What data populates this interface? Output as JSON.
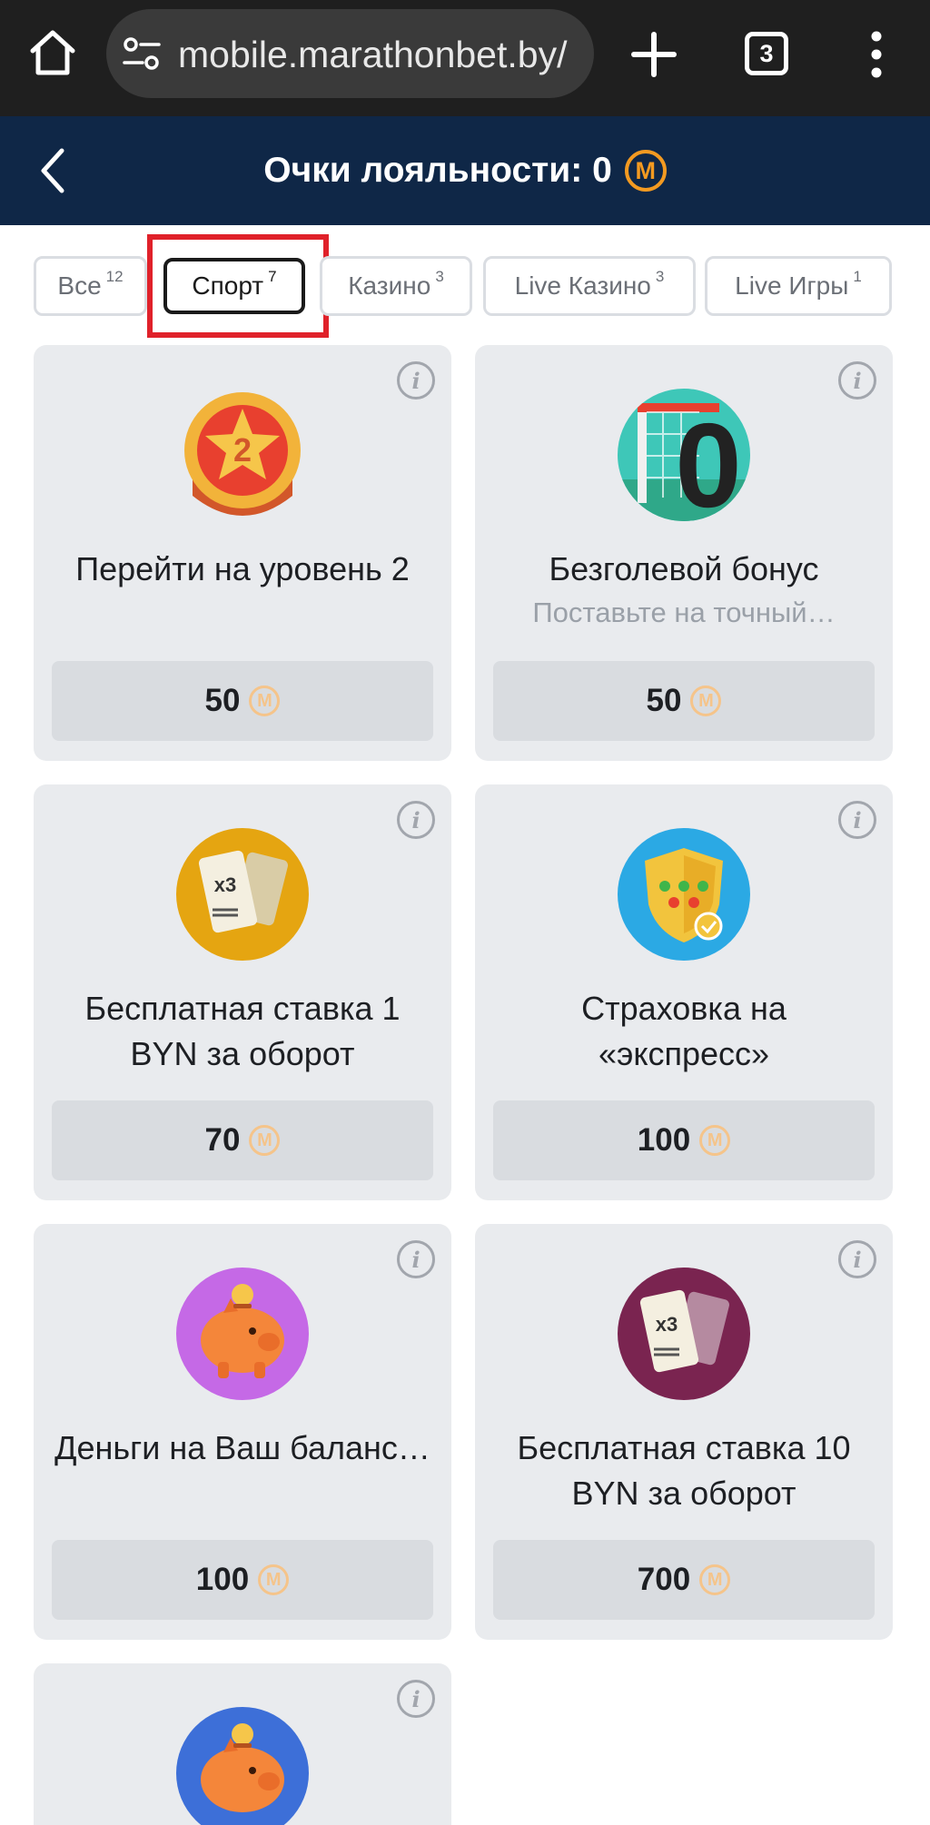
{
  "browser": {
    "url": "mobile.marathonbet.by/",
    "tab_count": "3"
  },
  "header": {
    "title": "Очки лояльности: 0",
    "coin_letter": "M"
  },
  "tabs": [
    {
      "label": "Все",
      "count": "12"
    },
    {
      "label": "Спорт",
      "count": "7"
    },
    {
      "label": "Казино",
      "count": "3"
    },
    {
      "label": "Live Казино",
      "count": "3"
    },
    {
      "label": "Live Игры",
      "count": "1"
    }
  ],
  "info_glyph": "i",
  "coin_letter": "M",
  "cards": [
    {
      "title": "Перейти на уровень 2",
      "subtitle": "",
      "price": "50",
      "icon": "level-2-medal-icon"
    },
    {
      "title": "Безголевой бонус",
      "subtitle": "Поставьте на точный…",
      "price": "50",
      "icon": "zero-goal-icon"
    },
    {
      "title": "Бесплатная ставка 1 BYN за оборот",
      "subtitle": "",
      "price": "70",
      "icon": "free-bet-ticket-gold-icon"
    },
    {
      "title": "Страховка на «экспресс»",
      "subtitle": "",
      "price": "100",
      "icon": "express-insurance-shield-icon"
    },
    {
      "title": "Деньги на Ваш баланс…",
      "subtitle": "",
      "price": "100",
      "icon": "piggy-bank-purple-icon"
    },
    {
      "title": "Бесплатная ставка 10 BYN за оборот",
      "subtitle": "",
      "price": "700",
      "icon": "free-bet-ticket-maroon-icon"
    },
    {
      "title": "",
      "subtitle": "",
      "price": "",
      "icon": "piggy-bank-blue-icon"
    }
  ]
}
